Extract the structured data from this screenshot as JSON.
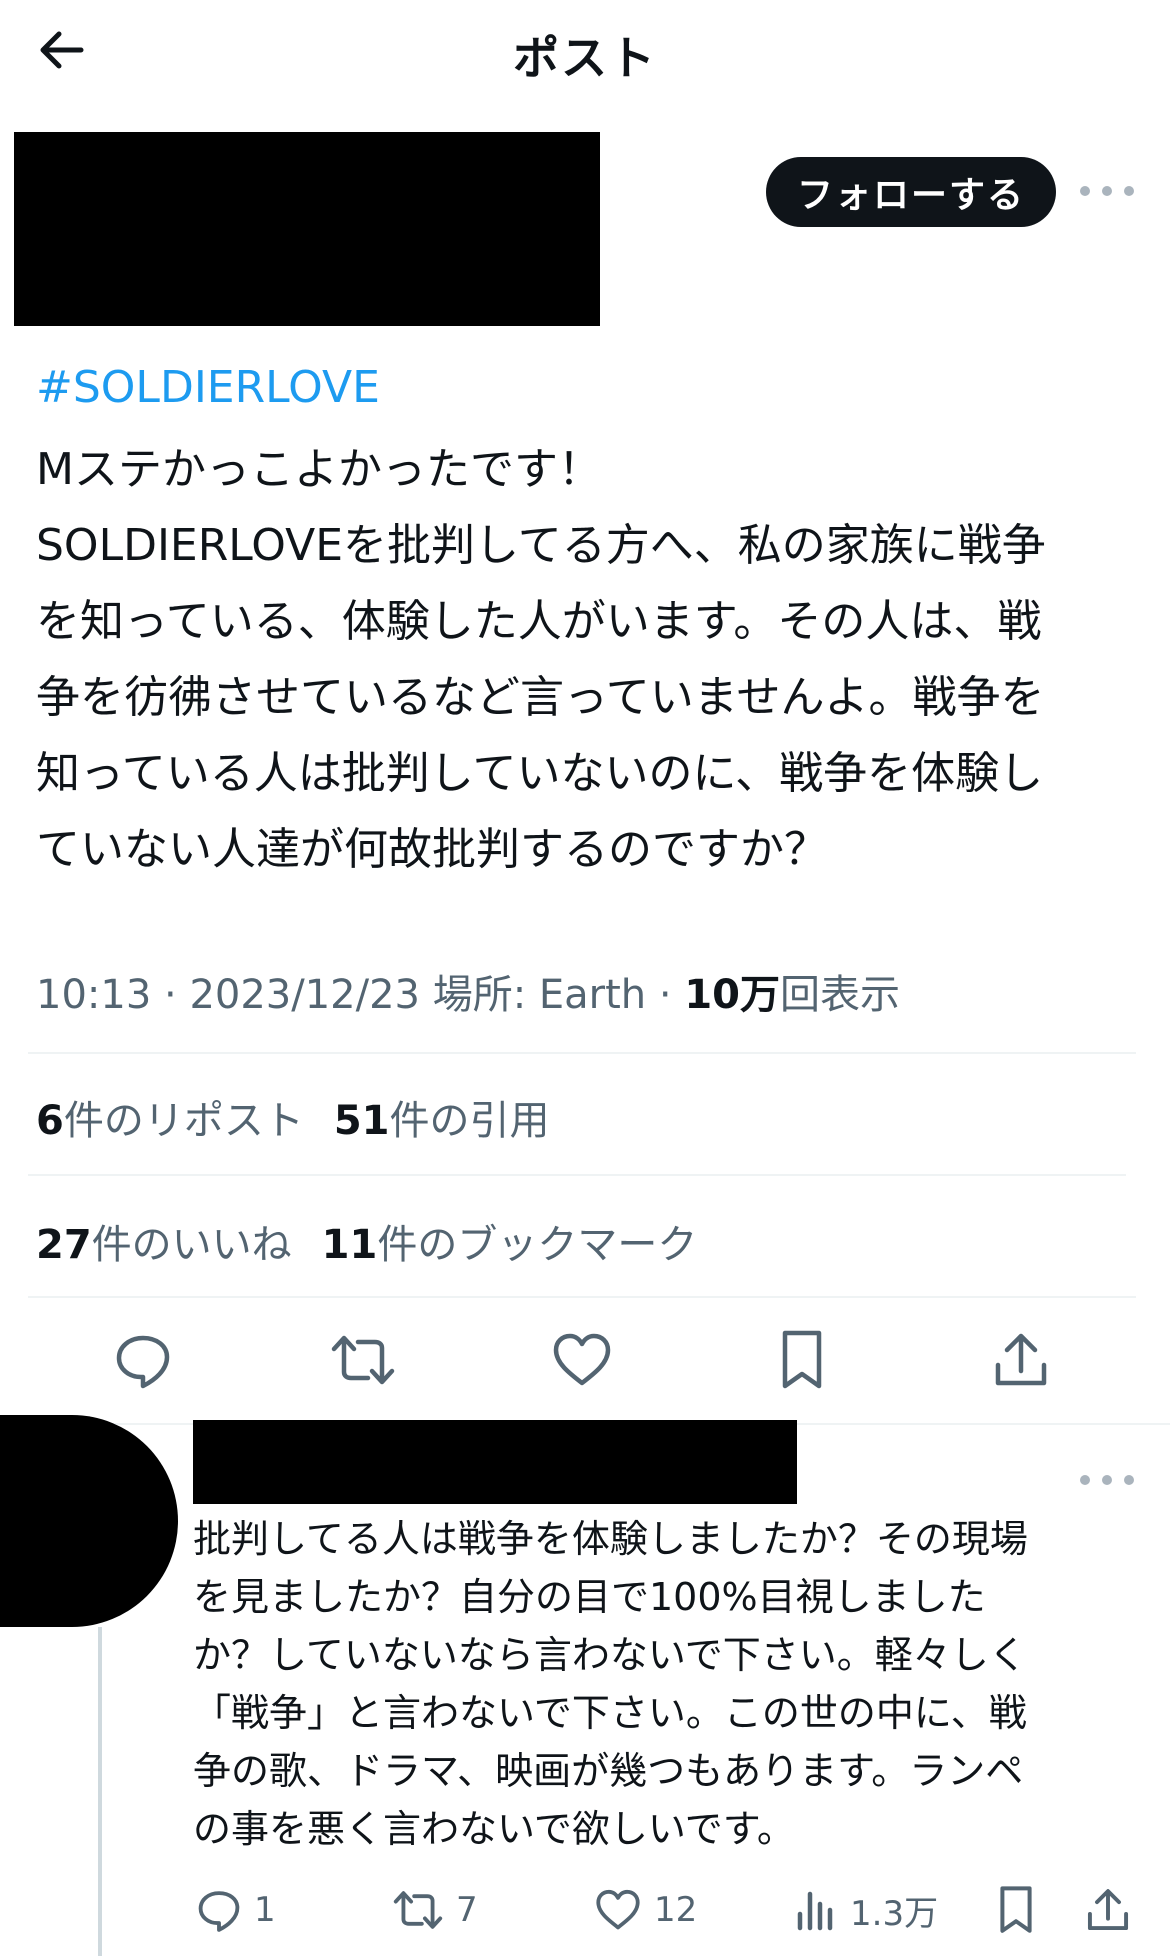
{
  "header": {
    "title": "ポスト",
    "back_icon": "arrow-left-icon"
  },
  "post": {
    "follow_label": "フォローする",
    "hashtag": "#SOLDIERLOVE",
    "text_lines": [
      "Mステかっこよかったです！",
      "SOLDIERLOVEを批判してる方へ、私の家族に戦争",
      "を知っている、体験した人がいます。その人は、戦",
      "争を彷彿させているなど言っていませんよ。戦争を",
      "知っている人は批判していないのに、戦争を体験し",
      "ていない人達が何故批判するのですか？"
    ],
    "time": "10:13",
    "date": "2023/12/23",
    "location_label": "場所: Earth",
    "views_count": "10万",
    "views_label": "回表示",
    "reposts_count": "6",
    "reposts_label": "件のリポスト",
    "quotes_count": "51",
    "quotes_label": "件の引用",
    "likes_count": "27",
    "likes_label": "件のいいね",
    "bookmarks_count": "11",
    "bookmarks_label": "件のブックマーク"
  },
  "reply": {
    "text_lines": [
      "批判してる人は戦争を体験しましたか？その現場",
      "を見ましたか？自分の目で100%目視しました",
      "か？していないなら言わないで下さい。軽々しく",
      "「戦争」と言わないで下さい。この世の中に、戦",
      "争の歌、ドラマ、映画が幾つもあります。ランペ",
      "の事を悪く言わないで欲しいです。"
    ],
    "replies": "1",
    "reposts": "7",
    "likes": "12",
    "views": "1.3万"
  },
  "colors": {
    "link": "#1d9bf0",
    "text": "#0f1419",
    "muted": "#536471",
    "divider": "#eff3f4"
  }
}
